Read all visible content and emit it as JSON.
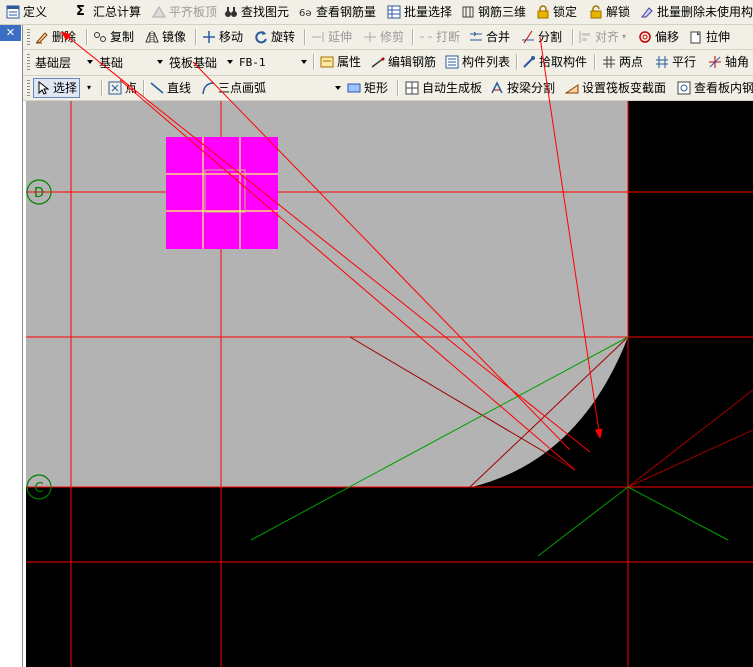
{
  "toolbar_main": {
    "define": "定义",
    "summary": "汇总计算",
    "flush_slab": "平齐板顶",
    "find_element": "查找图元",
    "view_rebar": "查看钢筋量",
    "batch_select": "批量选择",
    "rebar_3d": "钢筋三维",
    "lock": "锁定",
    "unlock": "解锁",
    "batch_delete": "批量删除未使用构"
  },
  "toolbar_edit": {
    "delete": "删除",
    "copy": "复制",
    "mirror": "镜像",
    "move": "移动",
    "rotate": "旋转",
    "extend": "延伸",
    "trim": "修剪",
    "break": "打断",
    "merge": "合并",
    "split": "分割",
    "align": "对齐",
    "offset": "偏移",
    "stretch": "拉伸"
  },
  "toolbar_layer": {
    "floor": "基础层",
    "category": "基础",
    "component_type": "筏板基础",
    "component": "FB-1",
    "properties": "属性",
    "edit_rebar": "编辑钢筋",
    "component_list": "构件列表",
    "pick_component": "拾取构件",
    "two_points": "两点",
    "parallel": "平行",
    "axis_angle": "轴角"
  },
  "toolbar_draw": {
    "select": "选择",
    "point": "点",
    "line": "直线",
    "arc": "三点画弧",
    "rect": "矩形",
    "auto_slab": "自动生成板",
    "split_by_beam": "按梁分割",
    "set_slope": "设置筏板变截面",
    "view_slab": "查看板内钢"
  },
  "axes": {
    "d": "D",
    "c": "C"
  },
  "colors": {
    "toolbar_bg": "#f1efe6",
    "canvas_black": "#000000",
    "slab_gray": "#b3b3b3",
    "grid_red": "#ff0000",
    "magenta": "#ff00ff",
    "axis_green": "#00a000"
  }
}
